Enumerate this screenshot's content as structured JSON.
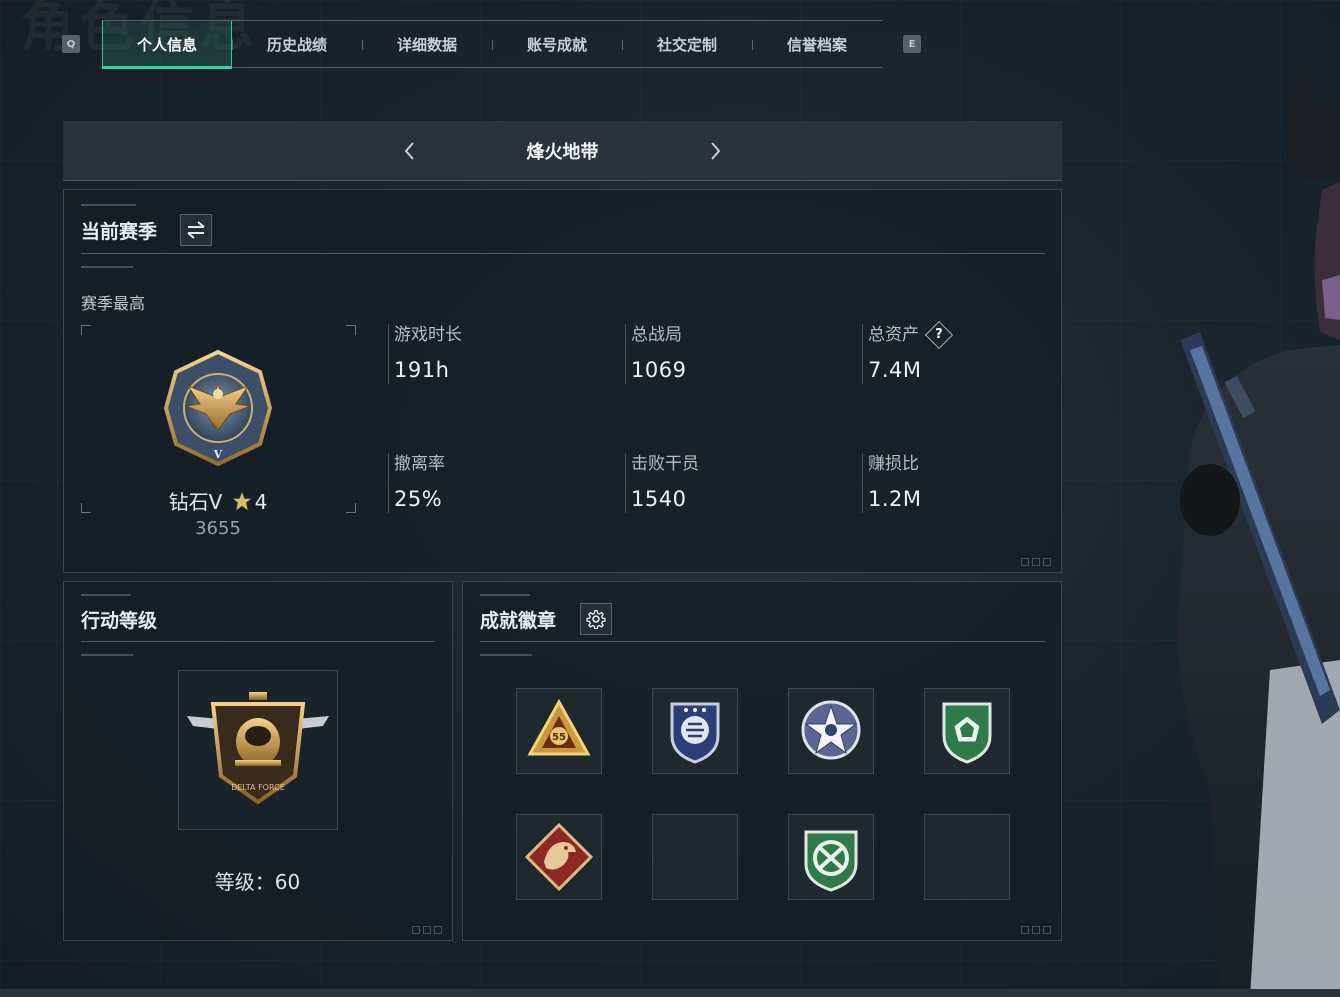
{
  "background_title": "角色信息",
  "tabs": [
    {
      "label": "个人信息",
      "active": true
    },
    {
      "label": "历史战绩",
      "active": false
    },
    {
      "label": "详细数据",
      "active": false
    },
    {
      "label": "账号成就",
      "active": false
    },
    {
      "label": "社交定制",
      "active": false
    },
    {
      "label": "信誉档案",
      "active": false
    }
  ],
  "keys": {
    "prev": "Q",
    "next": "E"
  },
  "mode": {
    "title": "烽火地带"
  },
  "season": {
    "title": "当前赛季",
    "best_label": "赛季最高",
    "rank_name": "钻石V",
    "rank_stars": "4",
    "rank_points": "3655",
    "stats": [
      {
        "label": "游戏时长",
        "value": "191h"
      },
      {
        "label": "总战局",
        "value": "1069"
      },
      {
        "label": "总资产",
        "value": "7.4M",
        "help": "?"
      },
      {
        "label": "撤离率",
        "value": "25%"
      },
      {
        "label": "击败干员",
        "value": "1540"
      },
      {
        "label": "赚损比",
        "value": "1.2M"
      }
    ]
  },
  "action_level": {
    "title": "行动等级",
    "level_text": "等级：60",
    "emblem_text": "DELTA FORCE"
  },
  "badges": {
    "title": "成就徽章",
    "slots": [
      {
        "icon": "gold-triangle-55-badge-icon",
        "empty": false
      },
      {
        "icon": "blue-shield-badge-icon",
        "empty": false
      },
      {
        "icon": "silver-star-badge-icon",
        "empty": false
      },
      {
        "icon": "green-shield-badge-icon",
        "empty": false
      },
      {
        "icon": "red-dragon-badge-icon",
        "empty": false
      },
      {
        "icon": "",
        "empty": true
      },
      {
        "icon": "green-arrows-shield-badge-icon",
        "empty": false
      },
      {
        "icon": "",
        "empty": true
      }
    ],
    "badge_number": "55"
  },
  "colors": {
    "accent": "#2fd69a",
    "panel": "#161d24",
    "text": "#d6dde2"
  }
}
